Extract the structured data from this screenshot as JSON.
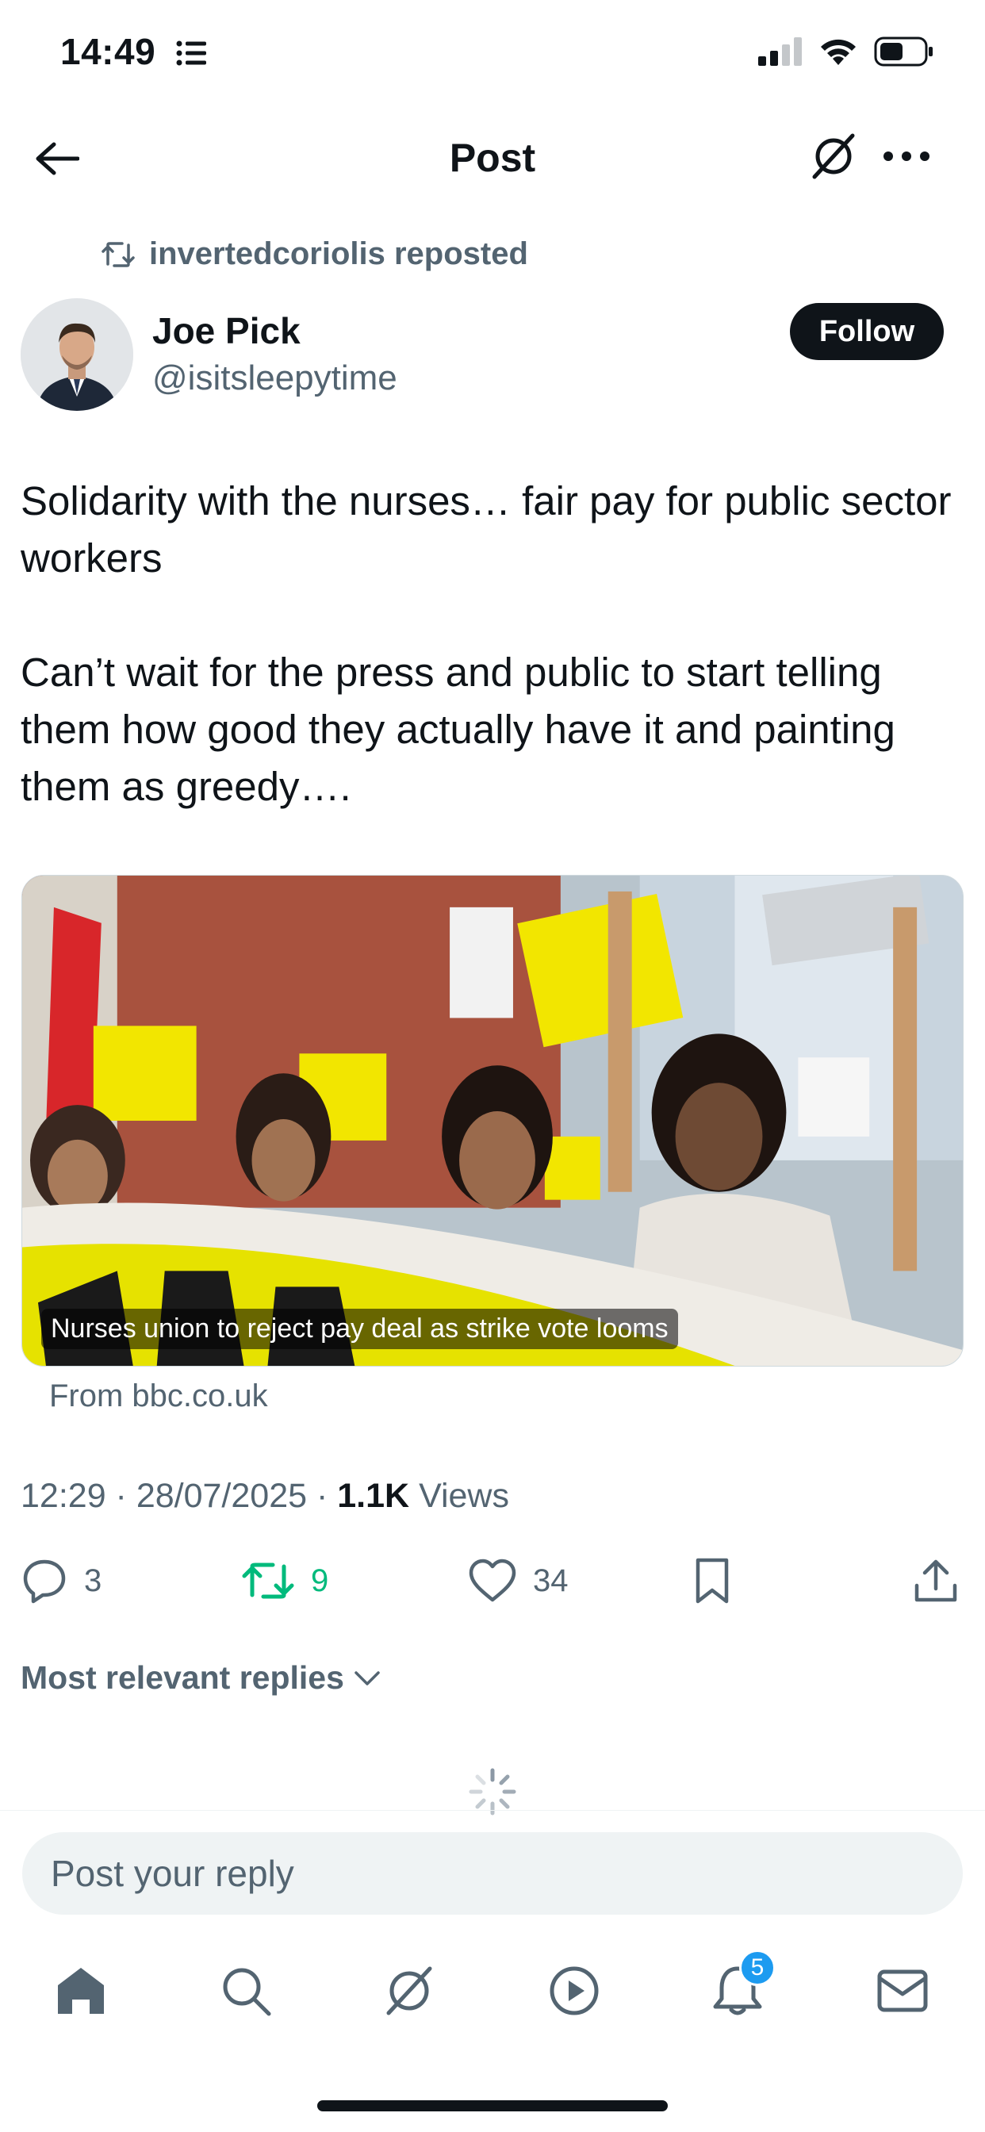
{
  "status_bar": {
    "time": "14:49"
  },
  "header": {
    "title": "Post"
  },
  "repost": {
    "text": "invertedcoriolis reposted"
  },
  "author": {
    "name": "Joe Pick",
    "handle": "@isitsleepytime",
    "follow_label": "Follow"
  },
  "post": {
    "paragraph_1": "Solidarity with the nurses… fair pay for public sector workers",
    "paragraph_2": "Can’t wait for the press and public to start telling them how good they actually have it and painting them as greedy…."
  },
  "link_card": {
    "caption": "Nurses union to reject pay deal as strike vote looms",
    "source": "From bbc.co.uk"
  },
  "meta": {
    "time": "12:29",
    "date": "28/07/2025",
    "views_count": "1.1K",
    "views_label": "Views"
  },
  "actions": {
    "replies": "3",
    "reposts": "9",
    "likes": "34"
  },
  "replies_sort": {
    "label": "Most relevant replies"
  },
  "reply_box": {
    "placeholder": "Post your reply"
  },
  "nav": {
    "notifications_badge": "5"
  },
  "colors": {
    "accent": "#1d9bf0",
    "repost_green": "#00ba7c",
    "text_secondary": "#536471",
    "text_primary": "#0f1419"
  }
}
